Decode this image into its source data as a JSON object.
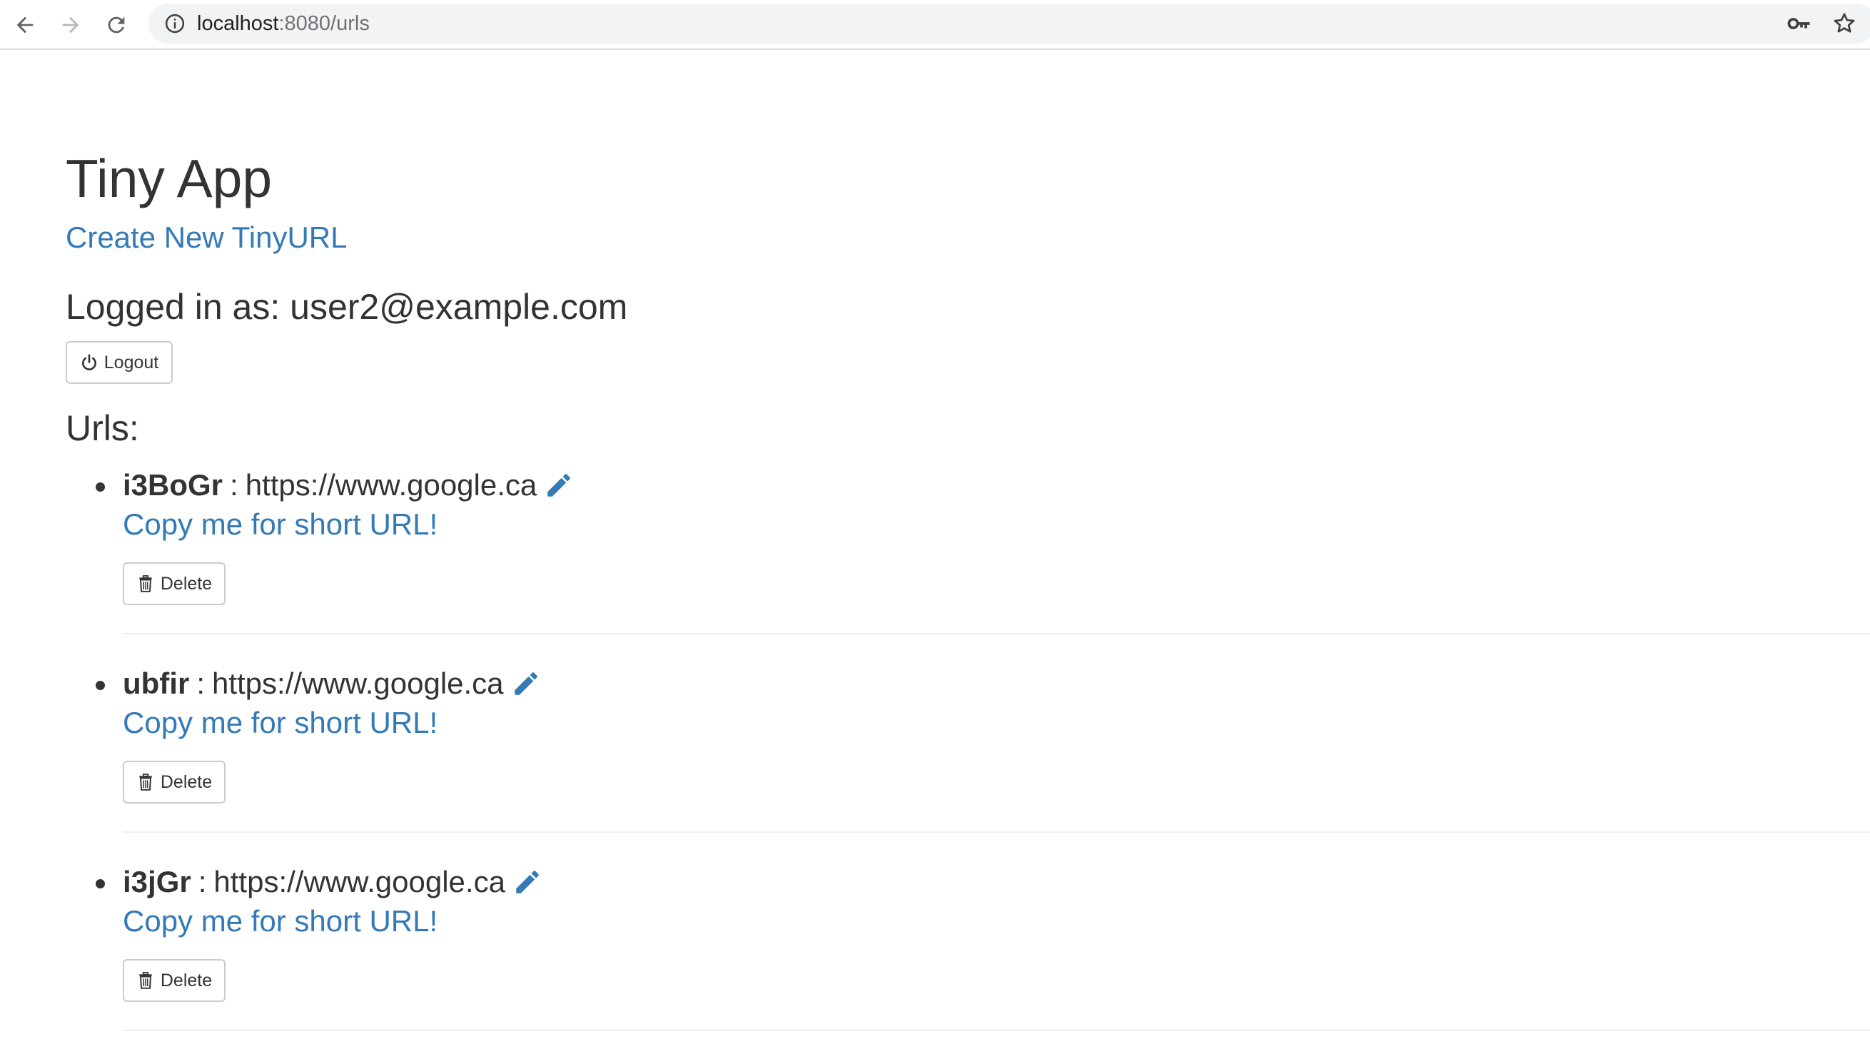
{
  "browser": {
    "url_host": "localhost",
    "url_rest": ":8080/urls"
  },
  "page": {
    "title": "Tiny App",
    "create_link": "Create New TinyURL",
    "logged_in": "Logged in as: user2@example.com",
    "logout_label": "Logout",
    "urls_heading": "Urls:"
  },
  "urls": [
    {
      "short": "i3BoGr",
      "sep": ":",
      "long": "https://www.google.ca",
      "copy_label": "Copy me for short URL!",
      "delete_label": "Delete"
    },
    {
      "short": "ubfir",
      "sep": ":",
      "long": "https://www.google.ca",
      "copy_label": "Copy me for short URL!",
      "delete_label": "Delete"
    },
    {
      "short": "i3jGr",
      "sep": ":",
      "long": "https://www.google.ca",
      "copy_label": "Copy me for short URL!",
      "delete_label": "Delete"
    }
  ],
  "colors": {
    "link": "#337ab7",
    "text": "#333333",
    "omnibox_bg": "#f1f3f4"
  },
  "icons": {
    "back": "arrow-left-icon",
    "forward": "arrow-right-icon",
    "reload": "reload-icon",
    "info": "info-icon",
    "key": "key-icon",
    "star": "star-icon",
    "power": "power-icon",
    "trash": "trash-icon",
    "pencil": "pencil-icon"
  }
}
